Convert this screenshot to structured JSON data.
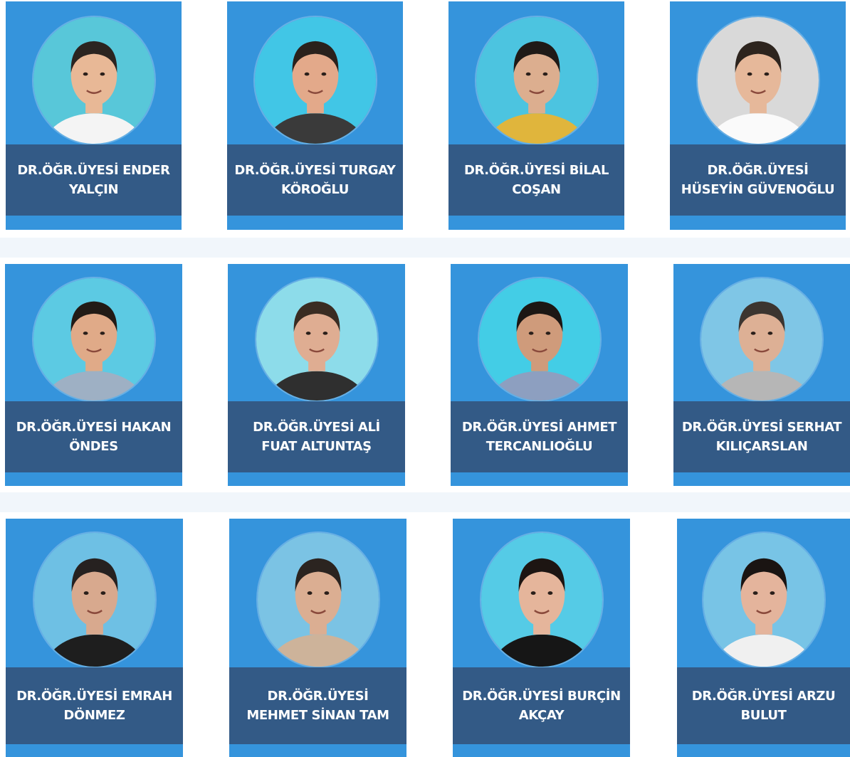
{
  "colors": {
    "card_bg": "#3594dc",
    "name_panel": "#335a86",
    "page_bg": "#f1f6fb"
  },
  "faculty": [
    {
      "name": "DR.ÖĞR.ÜYESİ ENDER YALÇIN",
      "photo_icon": "person-photo-icon"
    },
    {
      "name": "DR.ÖĞR.ÜYESİ TURGAY KÖROĞLU",
      "photo_icon": "person-photo-icon"
    },
    {
      "name": "DR.ÖĞR.ÜYESİ BİLAL COŞAN",
      "photo_icon": "person-photo-icon"
    },
    {
      "name": "DR.ÖĞR.ÜYESİ HÜSEYİN GÜVENOĞLU",
      "photo_icon": "person-photo-icon"
    },
    {
      "name": "DR.ÖĞR.ÜYESİ HAKAN ÖNDES",
      "photo_icon": "person-photo-icon"
    },
    {
      "name": "DR.ÖĞR.ÜYESİ ALİ FUAT ALTUNTAŞ",
      "photo_icon": "person-photo-icon"
    },
    {
      "name": "DR.ÖĞR.ÜYESİ AHMET TERCANLIOĞLU",
      "photo_icon": "person-photo-icon"
    },
    {
      "name": "DR.ÖĞR.ÜYESİ SERHAT KILIÇARSLAN",
      "photo_icon": "person-photo-icon"
    },
    {
      "name": "DR.ÖĞR.ÜYESİ EMRAH DÖNMEZ",
      "photo_icon": "person-photo-icon"
    },
    {
      "name": "DR.ÖĞR.ÜYESİ MEHMET SİNAN TAM",
      "photo_icon": "person-photo-icon"
    },
    {
      "name": "DR.ÖĞR.ÜYESİ BURÇİN AKÇAY",
      "photo_icon": "person-photo-icon"
    },
    {
      "name": "DR.ÖĞR.ÜYESİ ARZU BULUT",
      "photo_icon": "person-photo-icon"
    }
  ]
}
